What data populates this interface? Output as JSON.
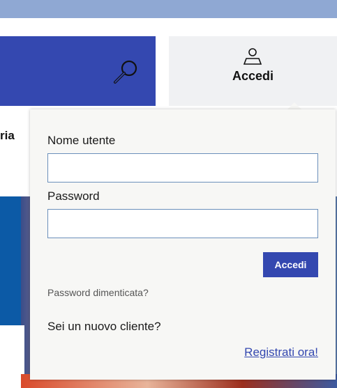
{
  "header": {
    "search_icon": "magnifier-icon",
    "login_icon": "user-icon",
    "login_label": "Accedi",
    "partial_nav_text": "ria"
  },
  "login_popup": {
    "username_label": "Nome utente",
    "username_value": "",
    "password_label": "Password",
    "password_value": "",
    "submit_label": "Accedi",
    "forgot_password": "Password dimenticata?",
    "new_customer_text": "Sei un nuovo cliente?",
    "register_link": "Registrati ora!"
  },
  "colors": {
    "primary": "#3448b0",
    "top_bar": "#8fa8d3",
    "input_border": "#6a8fba",
    "popup_bg": "#f7f7f5"
  }
}
